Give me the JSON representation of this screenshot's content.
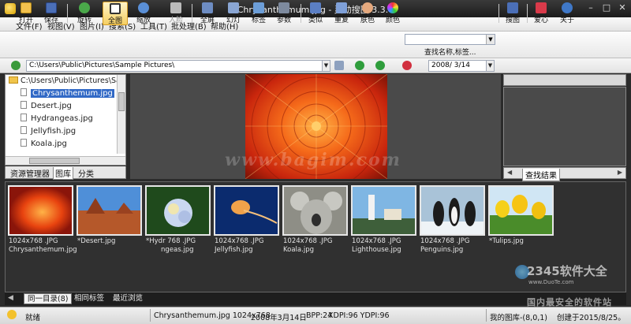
{
  "window": {
    "title": "Chrysanthemum.jpg - 灵动搜图 3.3.0"
  },
  "menu": [
    "文件(F)",
    "视图(V)",
    "图片(I)",
    "搜索(S)",
    "工具(T)",
    "批处理(B)",
    "帮助(H)"
  ],
  "toolbar": {
    "open": "打开",
    "save": "保存",
    "rotate": "旋转",
    "fit": "全图",
    "zoom": "缩放",
    "face": "人脸",
    "fullscreen": "全屏",
    "slideshow": "幻灯",
    "tag": "标签",
    "params": "参数",
    "similar": "类似",
    "duplicate": "重复",
    "skin": "肤色",
    "color": "颜色",
    "search_caption": "查找名称,标签...",
    "search_image": "搜图",
    "favorite": "爱心",
    "about": "关于"
  },
  "address": {
    "path": "C:\\Users\\Public\\Pictures\\Sample Pictures\\",
    "date": "2008/ 3/14"
  },
  "tree": {
    "root": "C:\\Users\\Public\\Pictures\\Sa",
    "items": [
      "Chrysanthemum.jpg",
      "Desert.jpg",
      "Hydrangeas.jpg",
      "Jellyfish.jpg",
      "Koala.jpg"
    ],
    "selected": "Chrysanthemum.jpg"
  },
  "left_tabs": [
    "资源管理器",
    "图库",
    "分类"
  ],
  "preview_watermark": "www.bagim.com",
  "right_panel": {
    "tab": "查找结果"
  },
  "thumbnails": [
    {
      "line1": "1024x768 .JPG",
      "line2": "Chrysanthemum.jpg"
    },
    {
      "line1": "",
      "line2": "*Desert.jpg"
    },
    {
      "line1": "*Hydr 768 .JPG",
      "line2": "ngeas.jpg"
    },
    {
      "line1": "1024x768 .JPG",
      "line2": "Jellyfish.jpg"
    },
    {
      "line1": "1024x768 .JPG",
      "line2": "Koala.jpg"
    },
    {
      "line1": "1024x768 .JPG",
      "line2": "Lighthouse.jpg"
    },
    {
      "line1": "1024x768 .JPG",
      "line2": "Penguins.jpg"
    },
    {
      "line1": "",
      "line2": "*Tulips.jpg"
    }
  ],
  "bottom_tabs": [
    "同一目录(8)",
    "相同标签",
    "最近浏览"
  ],
  "status": {
    "ready": "就绪",
    "info": "Chrysanthemum.jpg 1024x768",
    "date": "2008年3月14日",
    "bpp": "BPP:24",
    "dpi": "XDPI:96 YDPI:96",
    "library": "我的图库-(8,0,1)",
    "created": "创建于2015/8/25。"
  },
  "brand": {
    "logo_text": "2345软件大全",
    "sub": "www.DuoTe.com",
    "slogan": "国内最安全的软件站"
  }
}
